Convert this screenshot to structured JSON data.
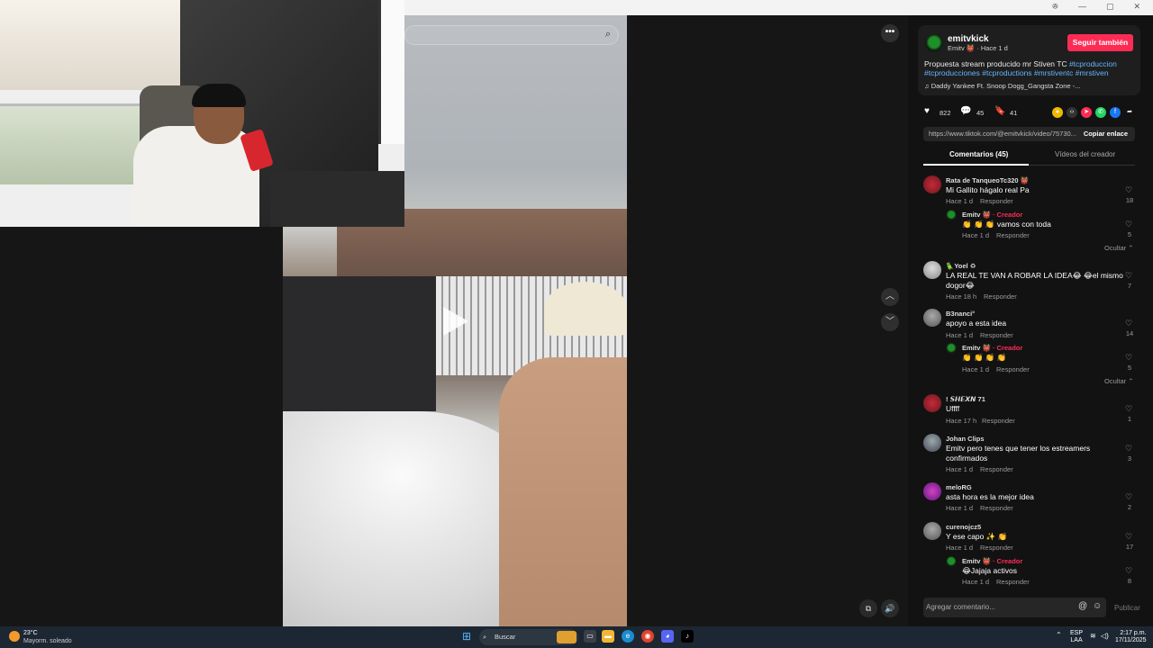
{
  "window": {
    "controls": [
      "ꔮ",
      "—",
      "▢",
      "✕"
    ]
  },
  "search": {
    "icon": "search-icon"
  },
  "video": {
    "more_label": "•••",
    "prev": "︿",
    "next": "﹀",
    "volume_icon": "speaker-icon",
    "pip_icon": "floating-window-icon"
  },
  "post": {
    "username": "emitvkick",
    "author_line": "Emitv 👹 · Hace 1 d",
    "follow_label": "Seguir también",
    "description_text": "Propuesta stream producido mr Stiven TC",
    "hashtags_line1": "#tcproduccion",
    "hashtags_line2": "#tcproducciones #tcproductions #mrstiventc #mrstiven",
    "music": "Daddy Yankee Ft. Snoop Dogg_Gangsta Zone -...",
    "likes": "822",
    "comments": "45",
    "saves": "41",
    "url": "https://www.tiktok.com/@emitvkick/video/75730...",
    "copy_label": "Copiar enlace"
  },
  "tabs": {
    "comments": "Comentarios (45)",
    "creator_videos": "Vídeos del creador"
  },
  "comments": [
    {
      "user": "Rata de TanqueoTc320 👹",
      "text": "Mi Gallito hágalo real Pa",
      "time": "Hace 1 d",
      "reply": "Responder",
      "likes": "18"
    },
    {
      "user": "Emitv 👹",
      "creator": "· Creador",
      "text": "👏 👏 👏 vamos con toda",
      "time": "Hace 1 d",
      "reply": "Responder",
      "likes": "5"
    },
    {
      "user": "🦜Yoel ♻",
      "text": "LA REAL TE VAN A ROBAR LA IDEA😂 😂el mismo",
      "text2": "dogor😂",
      "time": "Hace 18 h",
      "reply": "Responder",
      "likes": "7"
    },
    {
      "user": "B3nanci°",
      "text": "apoyo a esta idea",
      "time": "Hace 1 d",
      "reply": "Responder",
      "likes": "14"
    },
    {
      "user": "Emitv 👹",
      "creator": "· Creador",
      "text": "👏 👏 👏 👏",
      "time": "Hace 1 d",
      "reply": "Responder",
      "likes": "5"
    },
    {
      "user": "! 𝙎𝙃𝙀𝙓𝙉 71",
      "text": "Uffff",
      "time": "Hace 17 h",
      "reply": "Responder",
      "likes": "1"
    },
    {
      "user": "Johan Clips",
      "text": "Emitv pero tenes que tener los estreamers",
      "text2": "confirmados",
      "time": "Hace 1 d",
      "reply": "Responder",
      "likes": "3"
    },
    {
      "user": "meloRG",
      "text": "asta hora es la mejor idea",
      "time": "Hace 1 d",
      "reply": "Responder",
      "likes": "2"
    },
    {
      "user": "curenojcz5",
      "text": "Y ese capo ✨ 👏",
      "time": "Hace 1 d",
      "reply": "Responder",
      "likes": "17"
    },
    {
      "user": "Emitv 👹",
      "creator": "· Creador",
      "text": "😂Jajaja activos",
      "time": "Hace 1 d",
      "reply": "Responder",
      "likes": "8"
    }
  ],
  "hide_label": "Ocultar ⌃",
  "composer": {
    "placeholder": "Agregar comentario...",
    "at": "@",
    "emoji": "☺",
    "publish": "Publicar"
  },
  "taskbar": {
    "temp": "23°C",
    "weather": "Mayorm. soleado",
    "search": "Buscar",
    "lang1": "ESP",
    "lang2": "LAA",
    "time": "2:17 p.m.",
    "date": "17/11/2025"
  }
}
